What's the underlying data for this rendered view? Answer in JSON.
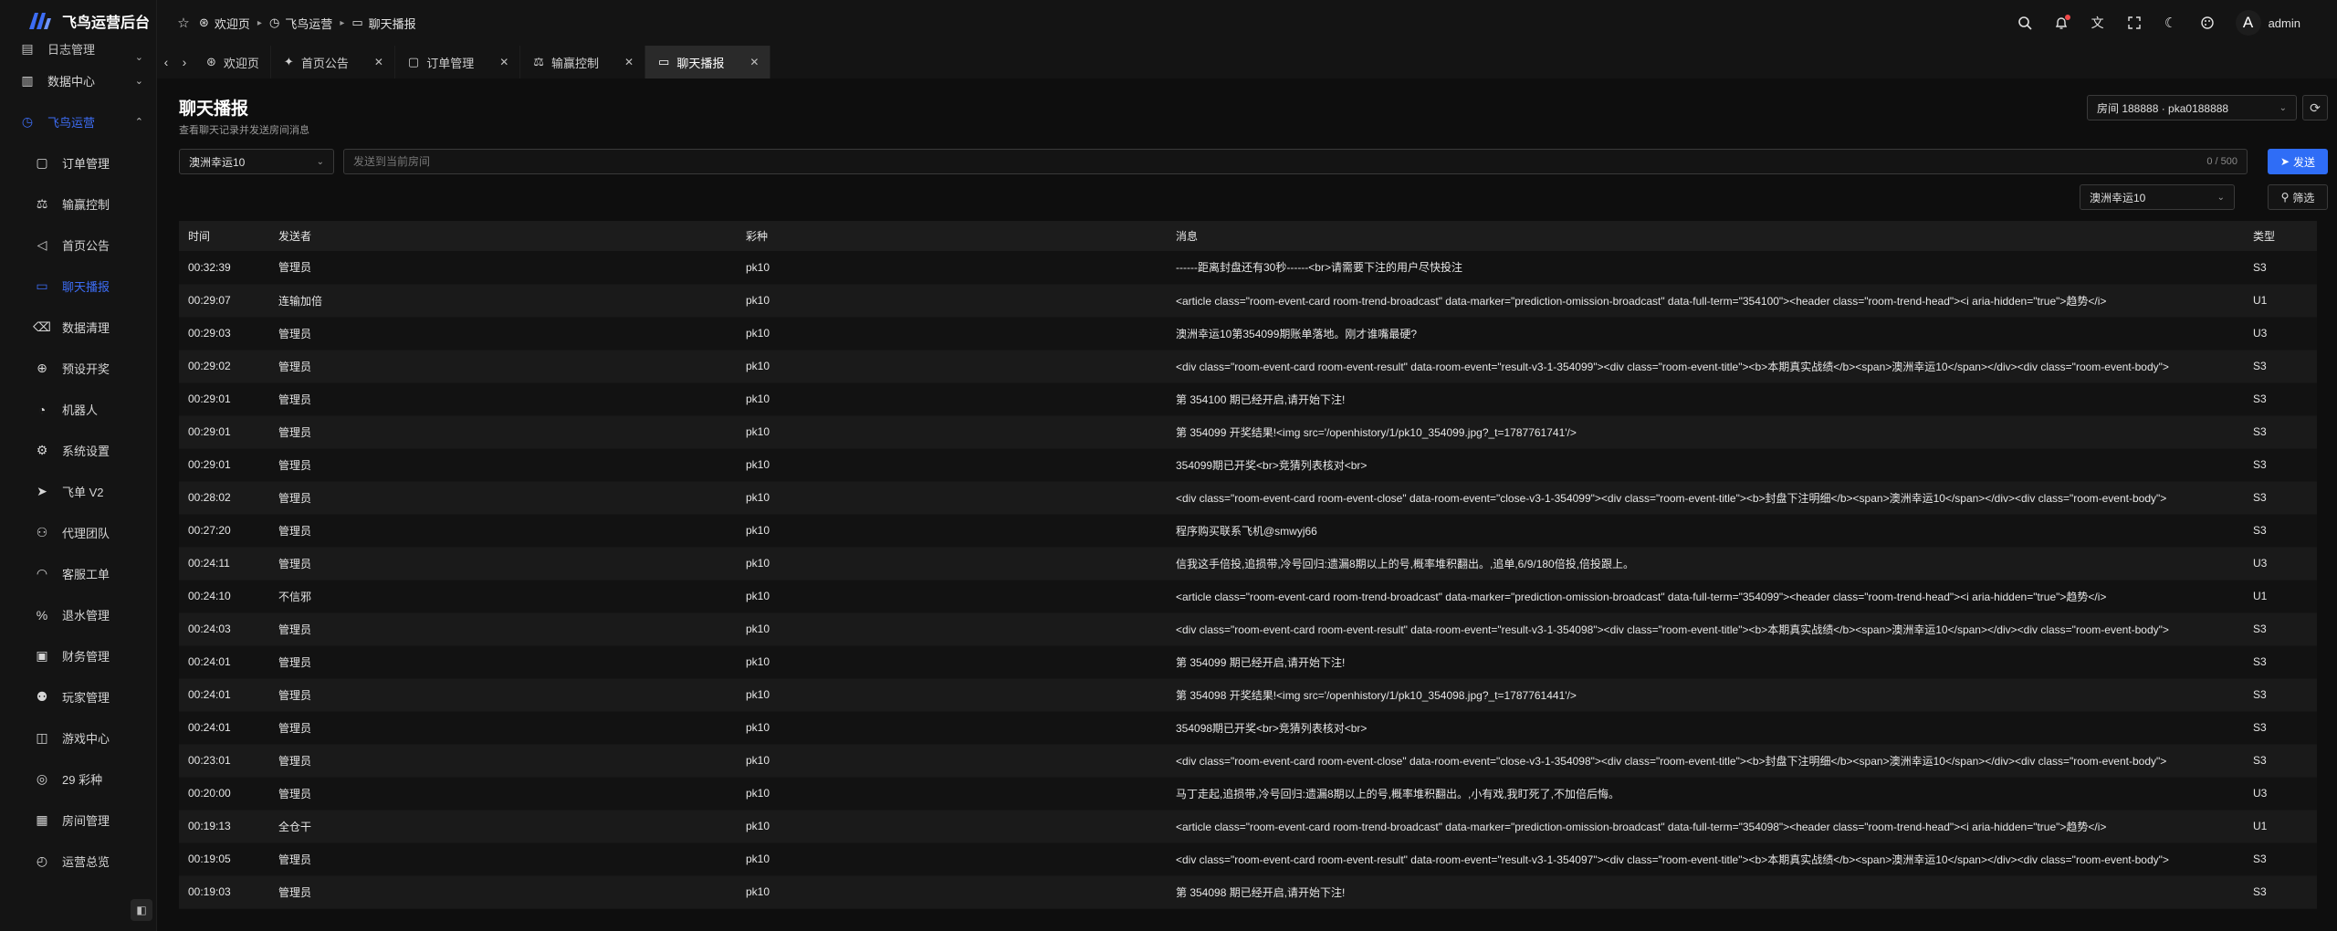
{
  "app": {
    "title": "飞鸟运营后台"
  },
  "sidebar": {
    "items": [
      {
        "label": "日志管理",
        "icon": "log-icon",
        "chevron": "⌄",
        "partial": true
      },
      {
        "label": "数据中心",
        "icon": "chart-icon",
        "chevron": "⌄"
      },
      {
        "label": "飞鸟运营",
        "icon": "clock-icon",
        "chevron": "⌃",
        "open": true
      },
      {
        "label": "订单管理",
        "icon": "document-icon",
        "child": true
      },
      {
        "label": "输赢控制",
        "icon": "scale-icon",
        "child": true
      },
      {
        "label": "首页公告",
        "icon": "megaphone-icon",
        "child": true
      },
      {
        "label": "聊天播报",
        "icon": "chat-icon",
        "child": true,
        "active": true
      },
      {
        "label": "数据清理",
        "icon": "trash-icon",
        "child": true
      },
      {
        "label": "预设开奖",
        "icon": "plus-circle-icon",
        "child": true
      },
      {
        "label": "机器人",
        "icon": "user-icon",
        "child": true
      },
      {
        "label": "系统设置",
        "icon": "settings-icon",
        "child": true
      },
      {
        "label": "飞单 V2",
        "icon": "send-icon",
        "child": true
      },
      {
        "label": "代理团队",
        "icon": "team-icon",
        "child": true
      },
      {
        "label": "客服工单",
        "icon": "headset-icon",
        "child": true
      },
      {
        "label": "退水管理",
        "icon": "percent-icon",
        "child": true
      },
      {
        "label": "财务管理",
        "icon": "wallet-icon",
        "child": true
      },
      {
        "label": "玩家管理",
        "icon": "players-icon",
        "child": true
      },
      {
        "label": "游戏中心",
        "icon": "gamepad-icon",
        "child": true
      },
      {
        "label": "29 彩种",
        "icon": "lottery-icon",
        "child": true
      },
      {
        "label": "房间管理",
        "icon": "building-icon",
        "child": true
      },
      {
        "label": "运营总览",
        "icon": "dashboard-icon",
        "child": true
      }
    ]
  },
  "header": {
    "breadcrumb": [
      {
        "label": "欢迎页",
        "icon": "globe-icon"
      },
      {
        "label": "飞鸟运营",
        "icon": "clock-icon"
      },
      {
        "label": "聊天播报",
        "icon": "chat-icon"
      }
    ],
    "user": {
      "avatar_letter": "A",
      "name": "admin"
    }
  },
  "tabs": [
    {
      "label": "欢迎页",
      "icon": "globe-icon",
      "closable": false
    },
    {
      "label": "首页公告",
      "icon": "pin-icon",
      "closable": true
    },
    {
      "label": "订单管理",
      "icon": "document-icon",
      "closable": true
    },
    {
      "label": "输赢控制",
      "icon": "scale-icon",
      "closable": true
    },
    {
      "label": "聊天播报",
      "icon": "chat-icon",
      "closable": true,
      "active": true
    }
  ],
  "page": {
    "title": "聊天播报",
    "subtitle": "查看聊天记录并发送房间消息",
    "room_select": "房间 188888 · pka0188888",
    "game_select": "澳洲幸运10",
    "message_placeholder": "发送到当前房间",
    "message_count": "0 / 500",
    "send_label": "发送",
    "filter_game": "澳洲幸运10",
    "filter_label": "筛选"
  },
  "table": {
    "columns": [
      "时间",
      "发送者",
      "彩种",
      "消息",
      "类型"
    ],
    "rows": [
      [
        "00:32:39",
        "管理员",
        "pk10",
        "------距离封盘还有30秒------<br>请需要下注的用户尽快投注",
        "S3"
      ],
      [
        "00:29:07",
        "连输加倍",
        "pk10",
        "<article class=\"room-event-card room-trend-broadcast\" data-marker=\"prediction-omission-broadcast\" data-full-term=\"354100\"><header class=\"room-trend-head\"><i aria-hidden=\"true\">趋势</i>",
        "U1"
      ],
      [
        "00:29:03",
        "管理员",
        "pk10",
        "澳洲幸运10第354099期账单落地。刚才谁嘴最硬?",
        "U3"
      ],
      [
        "00:29:02",
        "管理员",
        "pk10",
        "<div class=\"room-event-card room-event-result\" data-room-event=\"result-v3-1-354099\"><div class=\"room-event-title\"><b>本期真实战绩</b><span>澳洲幸运10</span></div><div class=\"room-event-body\">",
        "S3"
      ],
      [
        "00:29:01",
        "管理员",
        "pk10",
        "第 354100 期已经开启,请开始下注!",
        "S3"
      ],
      [
        "00:29:01",
        "管理员",
        "pk10",
        "第 354099 开奖结果!<img src='/openhistory/1/pk10_354099.jpg?_t=1787761741'/>",
        "S3"
      ],
      [
        "00:29:01",
        "管理员",
        "pk10",
        "354099期已开奖<br>竞猜列表核对<br>",
        "S3"
      ],
      [
        "00:28:02",
        "管理员",
        "pk10",
        "<div class=\"room-event-card room-event-close\" data-room-event=\"close-v3-1-354099\"><div class=\"room-event-title\"><b>封盘下注明细</b><span>澳洲幸运10</span></div><div class=\"room-event-body\">",
        "S3"
      ],
      [
        "00:27:20",
        "管理员",
        "pk10",
        "程序购买联系飞机@smwyj66",
        "S3"
      ],
      [
        "00:24:11",
        "管理员",
        "pk10",
        "信我这手倍投,追损带,冷号回归:遗漏8期以上的号,概率堆积翻出。,追单,6/9/180倍投,倍投跟上。",
        "U3"
      ],
      [
        "00:24:10",
        "不信邪",
        "pk10",
        "<article class=\"room-event-card room-trend-broadcast\" data-marker=\"prediction-omission-broadcast\" data-full-term=\"354099\"><header class=\"room-trend-head\"><i aria-hidden=\"true\">趋势</i>",
        "U1"
      ],
      [
        "00:24:03",
        "管理员",
        "pk10",
        "<div class=\"room-event-card room-event-result\" data-room-event=\"result-v3-1-354098\"><div class=\"room-event-title\"><b>本期真实战绩</b><span>澳洲幸运10</span></div><div class=\"room-event-body\">",
        "S3"
      ],
      [
        "00:24:01",
        "管理员",
        "pk10",
        "第 354099 期已经开启,请开始下注!",
        "S3"
      ],
      [
        "00:24:01",
        "管理员",
        "pk10",
        "第 354098 开奖结果!<img src='/openhistory/1/pk10_354098.jpg?_t=1787761441'/>",
        "S3"
      ],
      [
        "00:24:01",
        "管理员",
        "pk10",
        "354098期已开奖<br>竞猜列表核对<br>",
        "S3"
      ],
      [
        "00:23:01",
        "管理员",
        "pk10",
        "<div class=\"room-event-card room-event-close\" data-room-event=\"close-v3-1-354098\"><div class=\"room-event-title\"><b>封盘下注明细</b><span>澳洲幸运10</span></div><div class=\"room-event-body\">",
        "S3"
      ],
      [
        "00:20:00",
        "管理员",
        "pk10",
        "马丁走起,追损带,冷号回归:遗漏8期以上的号,概率堆积翻出。,小有戏,我盯死了,不加倍后悔。",
        "U3"
      ],
      [
        "00:19:13",
        "全仓干",
        "pk10",
        "<article class=\"room-event-card room-trend-broadcast\" data-marker=\"prediction-omission-broadcast\" data-full-term=\"354098\"><header class=\"room-trend-head\"><i aria-hidden=\"true\">趋势</i>",
        "U1"
      ],
      [
        "00:19:05",
        "管理员",
        "pk10",
        "<div class=\"room-event-card room-event-result\" data-room-event=\"result-v3-1-354097\"><div class=\"room-event-title\"><b>本期真实战绩</b><span>澳洲幸运10</span></div><div class=\"room-event-body\">",
        "S3"
      ],
      [
        "00:19:03",
        "管理员",
        "pk10",
        "第 354098 期已经开启,请开始下注!",
        "S3"
      ]
    ]
  },
  "colors": {
    "accent": "#3d6df5",
    "send_button": "#2f6df6",
    "background": "#0e0e0e",
    "panel": "#141414"
  }
}
